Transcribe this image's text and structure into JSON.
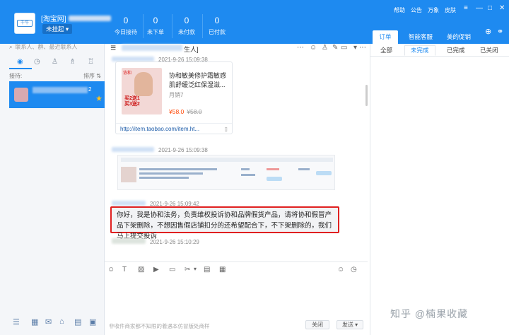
{
  "header": {
    "shop_prefix": "[淘宝网]",
    "status_button": "未挂起",
    "stats": [
      {
        "value": "0",
        "label": "今日接待"
      },
      {
        "value": "0",
        "label": "未下单"
      },
      {
        "value": "0",
        "label": "未付款"
      },
      {
        "value": "0",
        "label": "已付款"
      }
    ],
    "links": [
      "帮助",
      "公告",
      "万象",
      "皮肤"
    ],
    "right_tabs": [
      "订单",
      "智能客服",
      "美的促销"
    ]
  },
  "left": {
    "search_placeholder": "联系人、群、最近联系人",
    "queue_label": "接待:",
    "sort_label": "排序",
    "contact_badge": "2"
  },
  "chat": {
    "title_fragment": "生人]",
    "product_sender_time": "2021-9-26 15:09:38",
    "product_title": "协和敏美修护霜敏感肌舒缓泛红保湿滋...",
    "product_sales": "月销7",
    "product_price": "¥58.0",
    "product_orig_price": "¥58.0",
    "product_link": "http://item.taobao.com/item.ht...",
    "screenshot_sender_time": "2021-9-26 15:09:38",
    "text_sender_time": "2021-9-26 15:09:42",
    "message": "你好，我是协和法务，负责维权投诉协和品牌假货产品，请将协和假冒产品下架删除，不想因售假店铺扣分的还希望配合下，不下架删除的，我们马上提交投诉",
    "last_sender_time": "2021-9-26 15:10:29",
    "input_hint": "非收件商家都不知限的着遇本仿冒版处商样",
    "close_button": "关闭",
    "send_button": "发送"
  },
  "right_panel": {
    "order_tabs": [
      "全部",
      "未完成",
      "已完成",
      "已关闭"
    ],
    "active_tab": 1
  },
  "watermark": "知乎 @楠果收藏"
}
